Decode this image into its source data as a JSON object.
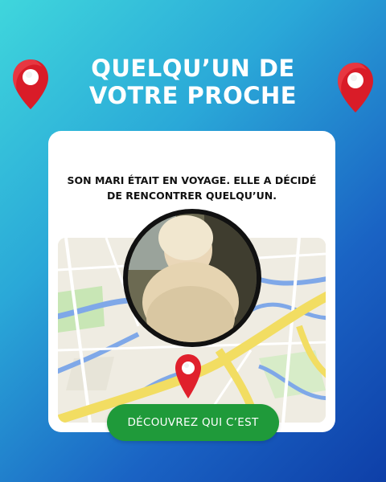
{
  "headline": "QUELQU’UN DE VOTRE PROCHE",
  "card": {
    "text": "SON MARI ÉTAIT EN VOYAGE. ELLE A DÉCIDÉ DE RENCONTRER QUELQU’UN."
  },
  "cta": {
    "label": "DÉCOUVREZ QUI C’EST"
  },
  "colors": {
    "gradient_start": "#3fd6dc",
    "gradient_end": "#0e3fa8",
    "cta_green": "#1f9a3a",
    "pin_red": "#e0202c"
  },
  "icons": {
    "left_pin": "map-pin-icon",
    "right_pin": "map-pin-icon",
    "map_pin": "map-pin-icon"
  }
}
